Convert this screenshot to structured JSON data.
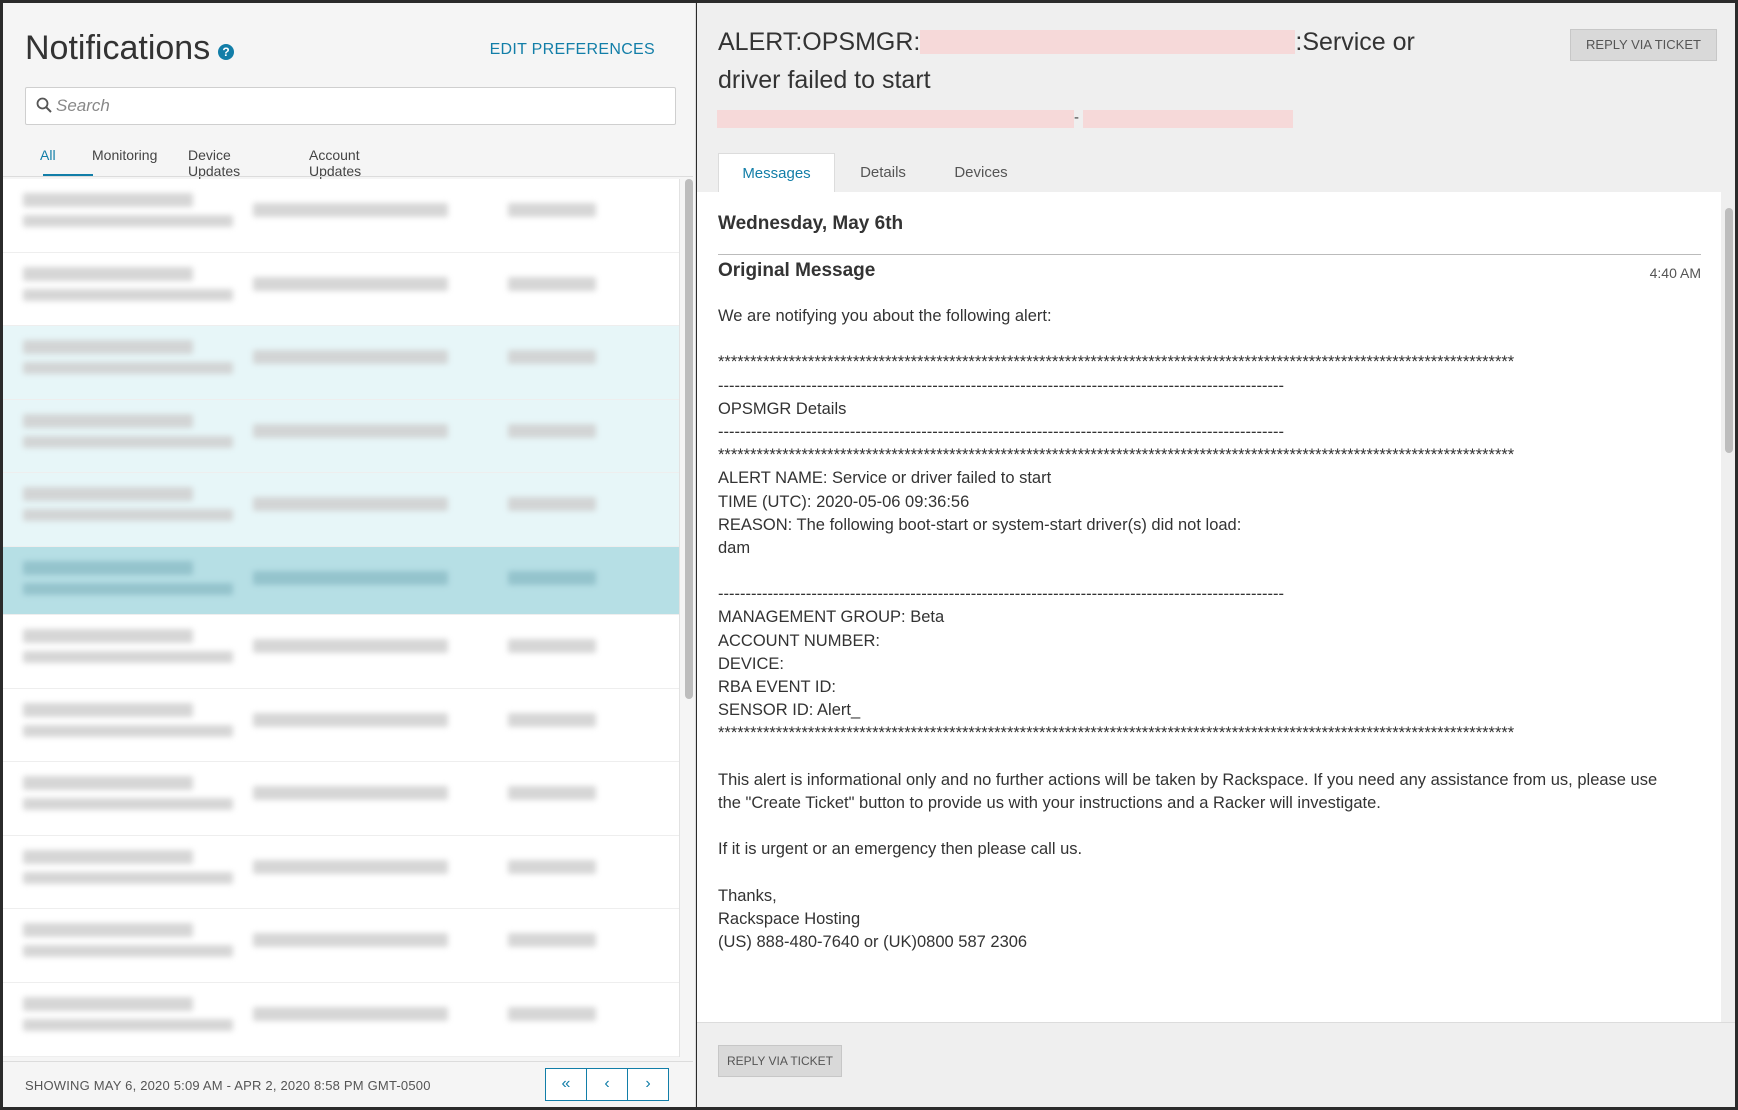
{
  "header": {
    "title": "Notifications",
    "help_glyph": "?",
    "edit_preferences": "EDIT PREFERENCES"
  },
  "search": {
    "placeholder": "Search"
  },
  "tabs": [
    {
      "label": "All",
      "active": true
    },
    {
      "label": "Monitoring"
    },
    {
      "label": "Device Updates"
    },
    {
      "label": "Account Updates"
    }
  ],
  "footer": {
    "showing": "SHOWING MAY 6, 2020 5:09 AM - APR 2, 2020 8:58 PM GMT-0500",
    "pager": [
      "«",
      "‹",
      "›"
    ]
  },
  "detail": {
    "title_prefix": "ALERT:OPSMGR:",
    "title_suffix": ":Service or driver failed to start",
    "subtitle_separator": "-",
    "reply_button": "REPLY VIA TICKET",
    "tabs": [
      {
        "label": "Messages",
        "active": true
      },
      {
        "label": "Details"
      },
      {
        "label": "Devices"
      }
    ],
    "date_heading": "Wednesday, May 6th",
    "message_heading": "Original Message",
    "message_time": "4:40 AM",
    "message_lines": [
      "We are notifying you about the following alert:",
      "",
      "****************************************************************************************************************************",
      "-------------------------------------------------------------------------------------------------------",
      "OPSMGR Details",
      "-------------------------------------------------------------------------------------------------------",
      "****************************************************************************************************************************",
      "ALERT NAME: Service or driver failed to start",
      "TIME (UTC): 2020-05-06 09:36:56",
      "REASON: The following boot-start or system-start driver(s) did not load:",
      "dam",
      "",
      "-------------------------------------------------------------------------------------------------------",
      "MANAGEMENT GROUP: Beta",
      "ACCOUNT NUMBER:",
      "DEVICE:",
      "RBA EVENT ID:",
      "SENSOR ID: Alert_",
      "****************************************************************************************************************************",
      "",
      "This alert is informational only and no further actions will be taken by Rackspace. If you need any assistance from us, please use",
      "the \"Create Ticket\" button to provide us with your instructions and a Racker will investigate.",
      "",
      "If it is urgent or an emergency then please call us.",
      "",
      "Thanks,",
      "Rackspace Hosting",
      "(US) 888-480-7640 or (UK)0800 587 2306"
    ],
    "reply_button_bottom": "REPLY VIA TICKET"
  },
  "colors": {
    "accent": "#127ea8",
    "row_highlight": "#e7f6f8",
    "row_selected": "#b6dfe5",
    "redaction": "#f6d9d9"
  },
  "icons": {
    "search": "search-icon",
    "help": "help-icon"
  },
  "list_rows": [
    {
      "state": "normal"
    },
    {
      "state": "normal"
    },
    {
      "state": "highlight"
    },
    {
      "state": "highlight"
    },
    {
      "state": "highlight"
    },
    {
      "state": "selected"
    },
    {
      "state": "normal"
    },
    {
      "state": "normal"
    },
    {
      "state": "normal"
    },
    {
      "state": "normal"
    },
    {
      "state": "normal"
    },
    {
      "state": "normal"
    }
  ]
}
